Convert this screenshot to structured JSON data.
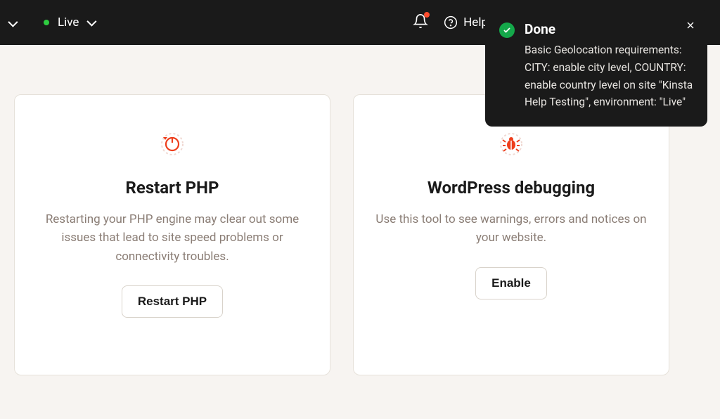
{
  "topbar": {
    "environment_label": "Live",
    "help_label": "Help"
  },
  "toast": {
    "title": "Done",
    "message": "Basic Geolocation require­ments: CITY: enable city level, COUNTRY: enable country level on site \"Kinsta Help Testing\", environment: \"Live\""
  },
  "cards": [
    {
      "title": "Restart PHP",
      "description": "Restarting your PHP engine may clear out some issues that lead to site speed problems or connectivity troubles.",
      "button": "Restart PHP"
    },
    {
      "title": "WordPress debugging",
      "description": "Use this tool to see warnings, errors and notices on your website.",
      "button": "Enable"
    }
  ]
}
